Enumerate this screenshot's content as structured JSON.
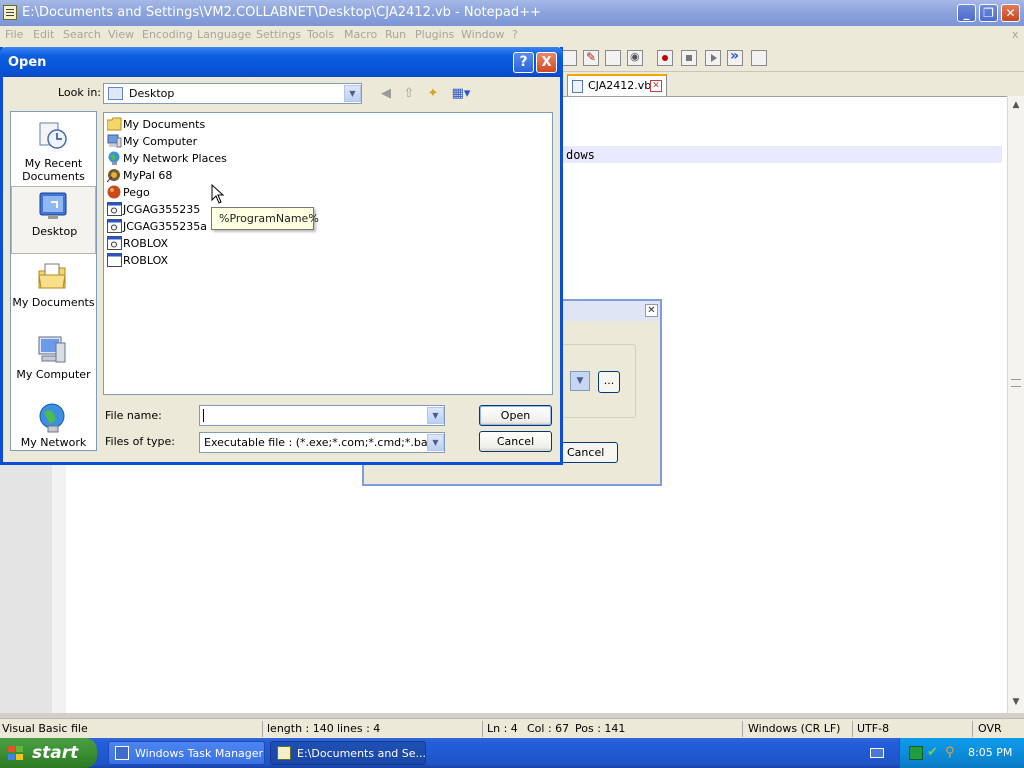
{
  "notepad": {
    "title": "E:\\Documents and Settings\\VM2.COLLABNET\\Desktop\\CJA2412.vb - Notepad++",
    "menu": [
      "File",
      "Edit",
      "Search",
      "View",
      "Encoding",
      "Language",
      "Settings",
      "Tools",
      "Macro",
      "Run",
      "Plugins",
      "Window",
      "?"
    ],
    "close_x": "x",
    "tab_label": "CJA2412.vb",
    "code_fragment": "dows",
    "status": {
      "lang": "Visual Basic file",
      "length": "length : 140",
      "lines": "lines : 4",
      "ln": "Ln : 4",
      "col": "Col : 67",
      "pos": "Pos : 141",
      "eol": "Windows (CR LF)",
      "encoding": "UTF-8",
      "mode": "OVR"
    }
  },
  "bg_dialog": {
    "ellipsis": "...",
    "cancel": "Cancel"
  },
  "open_dialog": {
    "title": "Open",
    "help": "?",
    "close": "X",
    "look_in_label": "Look in:",
    "look_in_value": "Desktop",
    "places": [
      {
        "label": "My Recent Documents",
        "icon": "recent-documents-icon"
      },
      {
        "label": "Desktop",
        "icon": "desktop-icon"
      },
      {
        "label": "My Documents",
        "icon": "my-documents-icon"
      },
      {
        "label": "My Computer",
        "icon": "my-computer-icon"
      },
      {
        "label": "My Network",
        "icon": "my-network-icon"
      }
    ],
    "files": [
      {
        "name": "My Documents",
        "icon": "folder-icon"
      },
      {
        "name": "My Computer",
        "icon": "computer-icon"
      },
      {
        "name": "My Network Places",
        "icon": "network-icon"
      },
      {
        "name": "MyPal 68",
        "icon": "app-icon"
      },
      {
        "name": "Pego",
        "icon": "app-icon"
      },
      {
        "name": "JCGAG355235",
        "icon": "exe-icon"
      },
      {
        "name": "JCGAG355235a",
        "icon": "exe-icon"
      },
      {
        "name": "ROBLOX",
        "icon": "exe-icon"
      },
      {
        "name": "ROBLOX",
        "icon": "window-icon"
      }
    ],
    "tooltip": "%ProgramName%",
    "file_name_label": "File name:",
    "file_name_value": "",
    "file_type_label": "Files of type:",
    "file_type_value": "Executable file :  (*.exe;*.com;*.cmd;*.bat)",
    "open_button": "Open",
    "cancel_button": "Cancel"
  },
  "taskbar": {
    "start": "start",
    "tasks": [
      {
        "label": "Windows Task Manager",
        "active": false
      },
      {
        "label": "E:\\Documents and Se...",
        "active": true
      }
    ],
    "clock": "8:05 PM"
  },
  "colors": {
    "xp_blue": "#0a4fd6",
    "tab_accent": "#f6a500",
    "start_green": "#3c8f32"
  }
}
